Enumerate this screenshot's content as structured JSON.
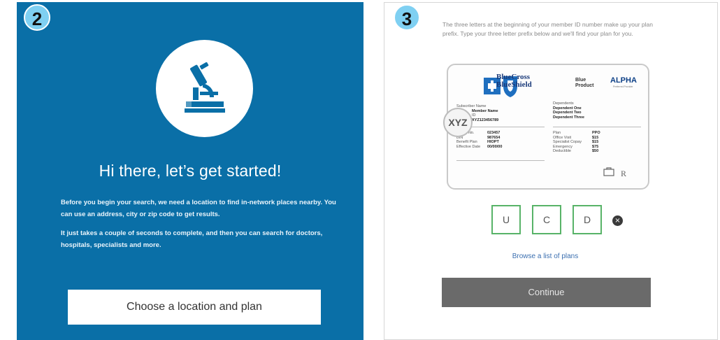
{
  "left_panel": {
    "step_number": "2",
    "heading": "Hi there, let’s get started!",
    "paragraph_1": "Before you begin your search, we need a location to find in-network places nearby. You can use an address, city or zip code to get results.",
    "paragraph_2": "It just takes a couple of seconds to complete, and then you can search for doctors, hospitals, specialists and more.",
    "button_label": "Choose a location and plan",
    "icon": "microscope-icon",
    "accent_color": "#0a6fa7"
  },
  "right_panel": {
    "step_number": "3",
    "instructions": "The three letters at the beginning of your member ID number make up your plan prefix. Type your three letter prefix below and we'll find your plan for you.",
    "card": {
      "brand_line_1": "BlueCross",
      "brand_line_2": "BlueShield",
      "product_line_1": "Blue",
      "product_line_2": "Product",
      "alpha_label": "ALPHA",
      "alpha_sub": "Preferred Provider",
      "prefix_callout": "XYZ",
      "subscriber_label": "Subscriber Name",
      "subscriber_value": "Member Name",
      "id_label": "ID",
      "id_value": "XYZ123456789",
      "dependents_label": "Dependents",
      "dependents": [
        "Dependent One",
        "Dependent Two",
        "Dependent Three"
      ],
      "group_rows": [
        {
          "label": "Group No.",
          "value": "023457"
        },
        {
          "label": "BIN",
          "value": "987654"
        },
        {
          "label": "Benefit Plan",
          "value": "HIOPT"
        },
        {
          "label": "Effective Date",
          "value": "00/00/00"
        }
      ],
      "copay_rows": [
        {
          "label": "Plan",
          "value": "PPO"
        },
        {
          "label": "Office Visit",
          "value": "$15"
        },
        {
          "label": "Specialist Copay",
          "value": "$15"
        },
        {
          "label": "Emergency",
          "value": "$75"
        },
        {
          "label": "Deductible",
          "value": "$50"
        }
      ],
      "r_mark": "R"
    },
    "prefix_letters": [
      "U",
      "C",
      "D"
    ],
    "browse_link": "Browse a list of plans",
    "continue_label": "Continue",
    "valid_color": "#58b368"
  }
}
